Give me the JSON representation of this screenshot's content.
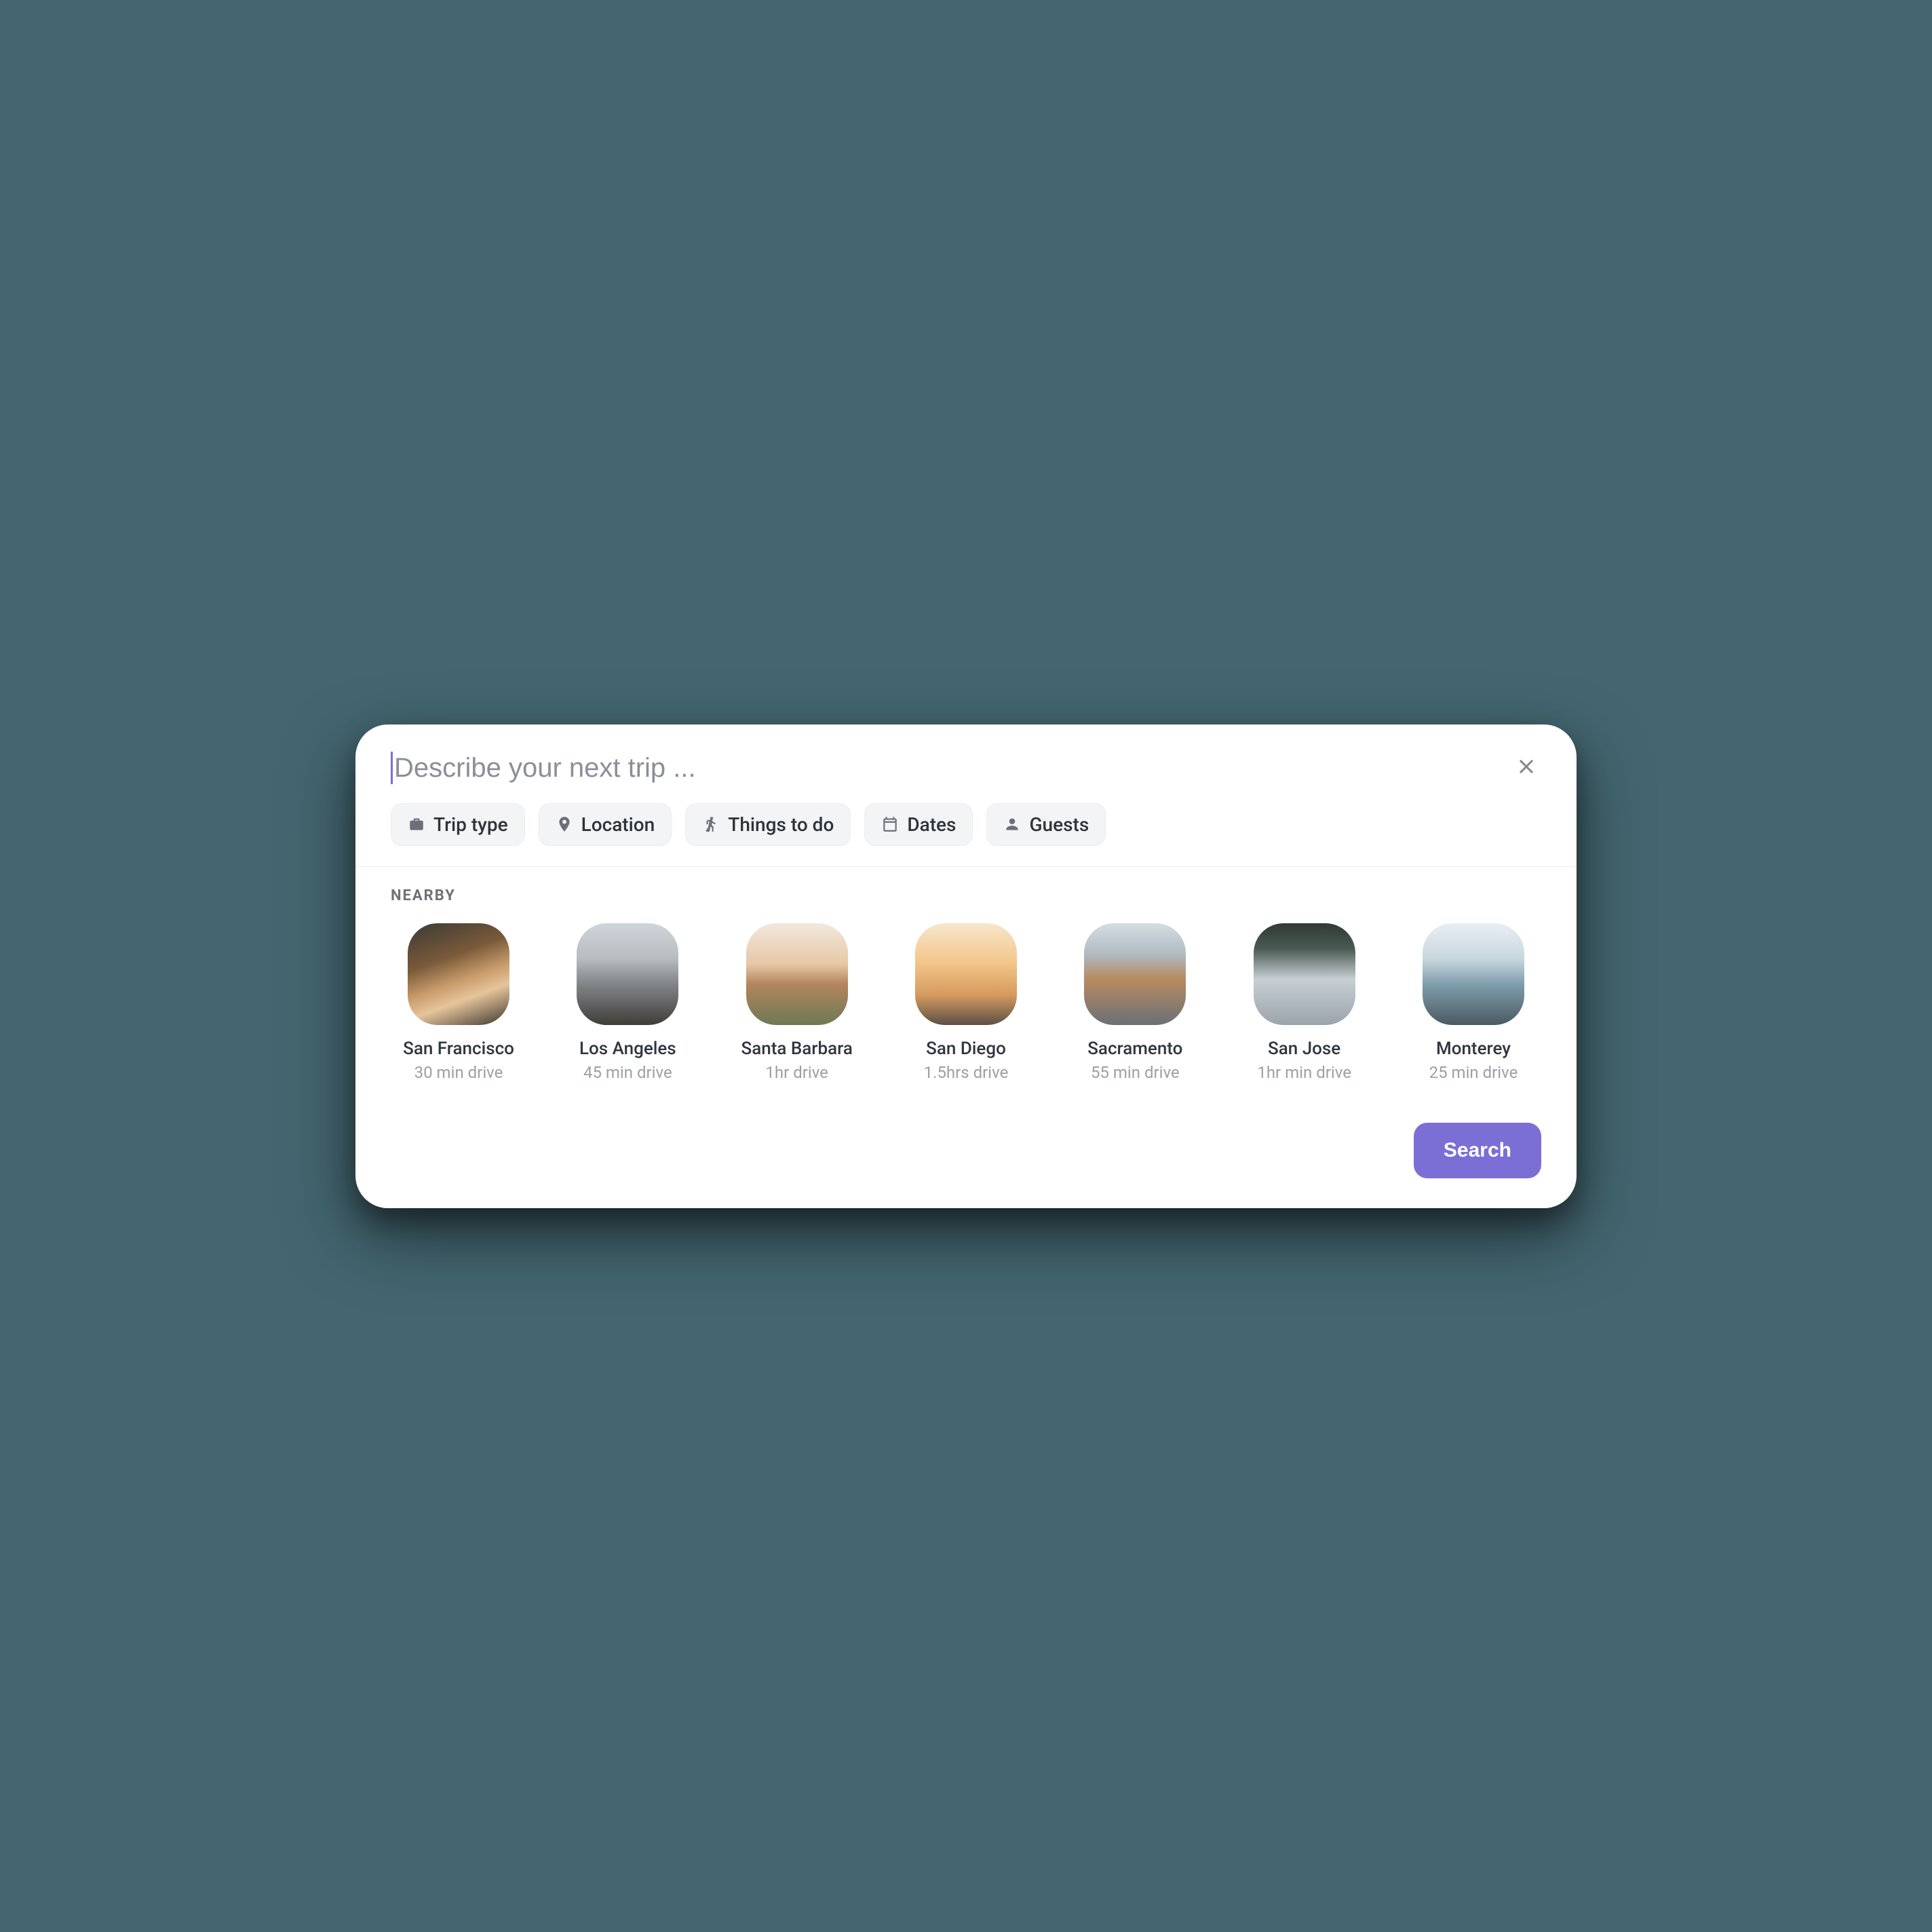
{
  "search": {
    "placeholder": "Describe your next trip ...",
    "value": ""
  },
  "chips": [
    {
      "icon": "briefcase-icon",
      "label": "Trip type"
    },
    {
      "icon": "location-pin-icon",
      "label": "Location"
    },
    {
      "icon": "hiker-icon",
      "label": "Things to do"
    },
    {
      "icon": "calendar-icon",
      "label": "Dates"
    },
    {
      "icon": "person-icon",
      "label": "Guests"
    }
  ],
  "nearby": {
    "title": "NEARBY",
    "items": [
      {
        "name": "San Francisco",
        "sub": "30 min drive"
      },
      {
        "name": "Los Angeles",
        "sub": "45 min drive"
      },
      {
        "name": "Santa Barbara",
        "sub": "1hr drive"
      },
      {
        "name": "San Diego",
        "sub": "1.5hrs drive"
      },
      {
        "name": "Sacramento",
        "sub": "55 min drive"
      },
      {
        "name": "San Jose",
        "sub": "1hr min drive"
      },
      {
        "name": "Monterey",
        "sub": "25 min drive"
      }
    ]
  },
  "actions": {
    "search_label": "Search"
  },
  "colors": {
    "accent": "#7b6fd6",
    "page_bg": "#446670"
  }
}
